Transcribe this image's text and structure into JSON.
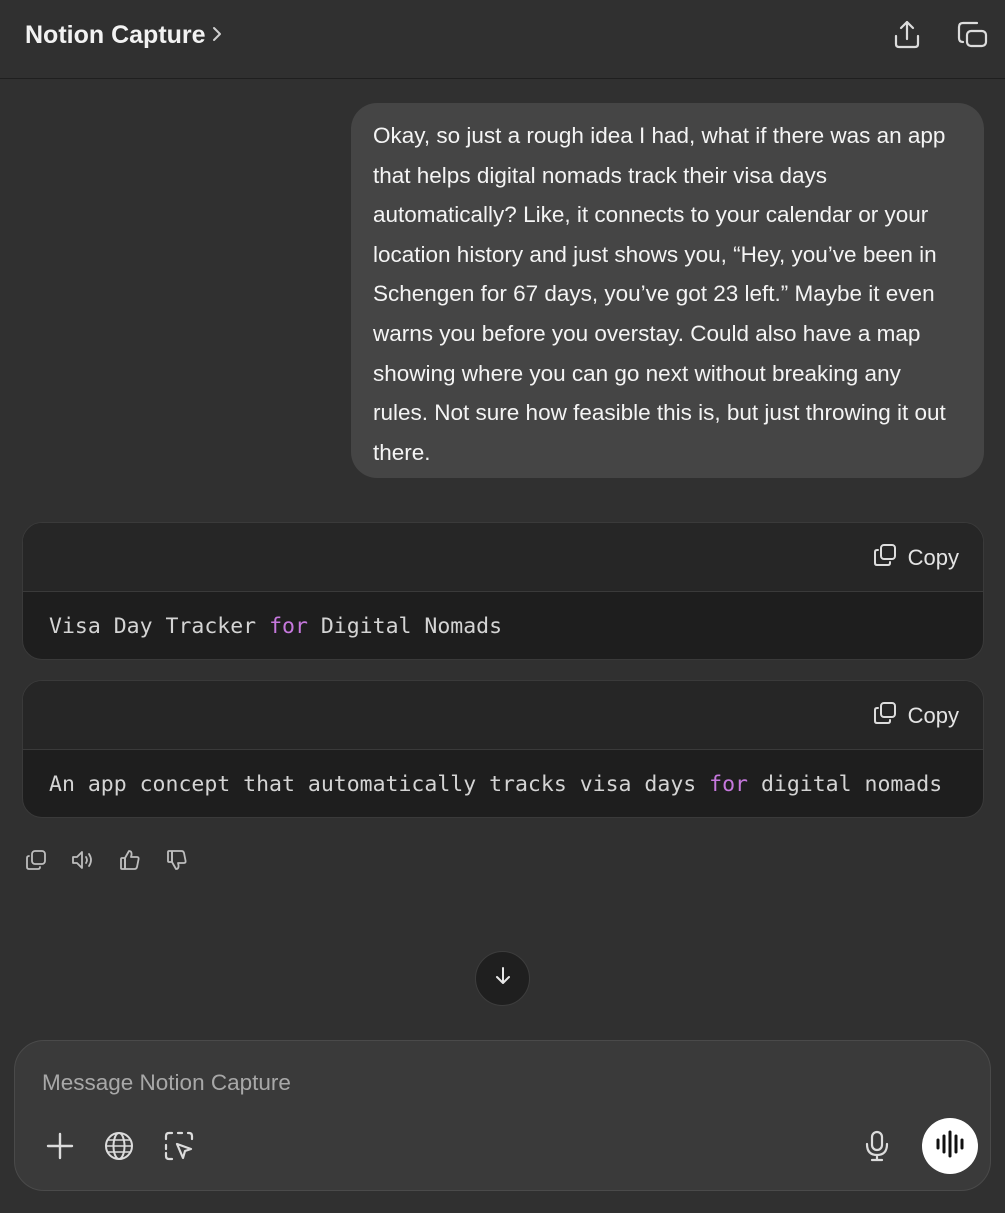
{
  "header": {
    "title": "Notion Capture",
    "chevron_icon": "chevron-right-icon",
    "share_icon": "share-icon",
    "new_window_icon": "new-window-icon"
  },
  "conversation": {
    "user_message": "Okay, so just a rough idea I had, what if there was an app that helps digital nomads track their visa days automatically? Like, it connects to your calendar or your location history and just shows you, “Hey, you’ve been in Schengen for 67 days, you’ve got 23 left.” Maybe it even warns you before you overstay. Could also have a map showing where you can go next without breaking any rules. Not sure how feasible this is, but just throwing it out there.",
    "code_blocks": [
      {
        "copy_label": "Copy",
        "code_before": "Visa Day Tracker ",
        "code_keyword": "for",
        "code_after": " Digital Nomads"
      },
      {
        "copy_label": "Copy",
        "code_before": "An app concept that automatically tracks visa days ",
        "code_keyword": "for",
        "code_after": " digital nomads"
      }
    ],
    "message_actions": [
      "copy-icon",
      "read-aloud-icon",
      "thumbs-up-icon",
      "thumbs-down-icon"
    ]
  },
  "scroll_button_icon": "arrow-down-icon",
  "composer": {
    "placeholder": "Message Notion Capture",
    "value": "",
    "left_buttons": [
      "plus-icon",
      "globe-icon",
      "screen-select-icon"
    ],
    "mic_icon": "microphone-icon",
    "voice_icon": "voice-mode-icon"
  },
  "colors": {
    "background": "#303030",
    "user_bubble": "#454545",
    "code_background": "#1e1e1e",
    "keyword": "#c678dd",
    "voice_button": "#ffffff"
  }
}
